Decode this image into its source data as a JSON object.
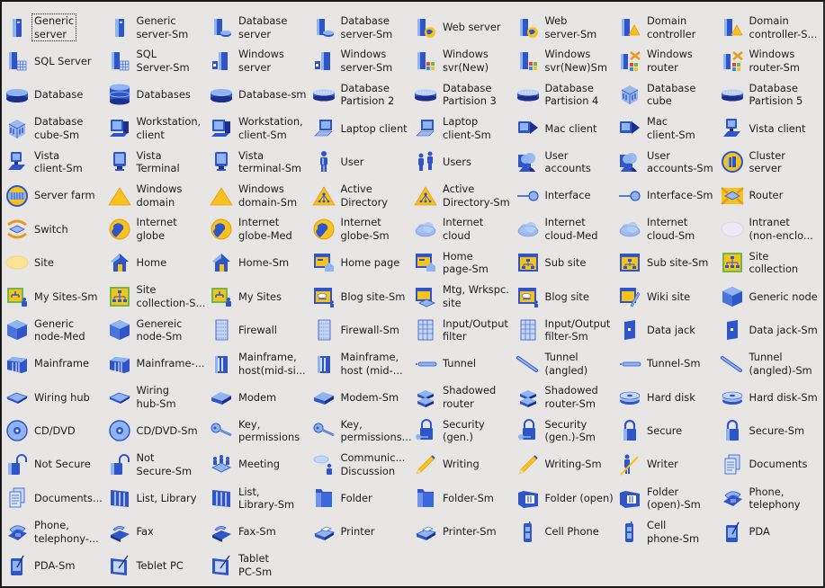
{
  "window": {
    "type": "Visio shape stencil icon view"
  },
  "selected_index": 0,
  "shapes": [
    {
      "label": "Generic\nserver",
      "icon": "generic-server-icon"
    },
    {
      "label": "Generic\nserver-Sm",
      "icon": "generic-server-icon"
    },
    {
      "label": "Database\nserver",
      "icon": "database-server-icon"
    },
    {
      "label": "Database\nserver-Sm",
      "icon": "database-server-icon"
    },
    {
      "label": "Web server",
      "icon": "web-server-icon"
    },
    {
      "label": "Web\nserver-Sm",
      "icon": "web-server-icon"
    },
    {
      "label": "Domain\ncontroller",
      "icon": "domain-controller-icon"
    },
    {
      "label": "Domain\ncontroller-S...",
      "icon": "domain-controller-icon"
    },
    {
      "label": "SQL Server",
      "icon": "sql-server-icon"
    },
    {
      "label": "SQL\nServer-Sm",
      "icon": "sql-server-icon"
    },
    {
      "label": "Windows\nserver",
      "icon": "windows-server-icon"
    },
    {
      "label": "Windows\nserver-Sm",
      "icon": "windows-server-icon"
    },
    {
      "label": "Windows\nsvr(New)",
      "icon": "windows-svr-new-icon"
    },
    {
      "label": "Windows\nsvr(New)Sm",
      "icon": "windows-svr-new-icon"
    },
    {
      "label": "Windows\nrouter",
      "icon": "windows-router-icon"
    },
    {
      "label": "Windows\nrouter-Sm",
      "icon": "windows-router-icon"
    },
    {
      "label": "Database",
      "icon": "database-icon"
    },
    {
      "label": "Databases",
      "icon": "databases-icon"
    },
    {
      "label": "Database-sm",
      "icon": "database-icon"
    },
    {
      "label": "Database\nPartision 2",
      "icon": "database-partition-icon"
    },
    {
      "label": "Database\nPartision 3",
      "icon": "database-partition-icon"
    },
    {
      "label": "Database\nPartision 4",
      "icon": "database-partition-icon"
    },
    {
      "label": "Database\ncube",
      "icon": "database-cube-icon"
    },
    {
      "label": "Database\nPartision 5",
      "icon": "database-partition-icon"
    },
    {
      "label": "Database\ncube-Sm",
      "icon": "database-cube-icon"
    },
    {
      "label": "Workstation,\nclient",
      "icon": "workstation-icon"
    },
    {
      "label": "Workstation,\nclient-Sm",
      "icon": "workstation-icon"
    },
    {
      "label": "Laptop client",
      "icon": "laptop-icon"
    },
    {
      "label": "Laptop\nclient-Sm",
      "icon": "laptop-icon"
    },
    {
      "label": "Mac client",
      "icon": "mac-client-icon"
    },
    {
      "label": "Mac\nclient-Sm",
      "icon": "mac-client-icon"
    },
    {
      "label": "Vista client",
      "icon": "vista-client-icon"
    },
    {
      "label": "Vista\nclient-Sm",
      "icon": "vista-client-icon"
    },
    {
      "label": "Vista\nTerminal",
      "icon": "vista-terminal-icon"
    },
    {
      "label": "Vista\nterminal-Sm",
      "icon": "vista-terminal-icon"
    },
    {
      "label": "User",
      "icon": "user-icon"
    },
    {
      "label": "Users",
      "icon": "users-icon"
    },
    {
      "label": "User\naccounts",
      "icon": "user-accounts-icon"
    },
    {
      "label": "User\naccounts-Sm",
      "icon": "user-accounts-icon"
    },
    {
      "label": "Cluster server",
      "icon": "cluster-server-icon"
    },
    {
      "label": "Server farm",
      "icon": "server-farm-icon"
    },
    {
      "label": "Windows\ndomain",
      "icon": "windows-domain-icon"
    },
    {
      "label": "Windows\ndomain-Sm",
      "icon": "windows-domain-icon"
    },
    {
      "label": "Active\nDirectory",
      "icon": "active-directory-icon"
    },
    {
      "label": "Active\nDirectory-Sm",
      "icon": "active-directory-icon"
    },
    {
      "label": "Interface",
      "icon": "interface-icon"
    },
    {
      "label": "Interface-Sm",
      "icon": "interface-icon"
    },
    {
      "label": "Router",
      "icon": "router-icon"
    },
    {
      "label": "Switch",
      "icon": "switch-icon"
    },
    {
      "label": "Internet\nglobe",
      "icon": "internet-globe-icon"
    },
    {
      "label": "Internet\nglobe-Med",
      "icon": "internet-globe-icon"
    },
    {
      "label": "Internet\nglobe-Sm",
      "icon": "internet-globe-icon"
    },
    {
      "label": "Internet\ncloud",
      "icon": "internet-cloud-icon"
    },
    {
      "label": "Internet\ncloud-Med",
      "icon": "internet-cloud-icon"
    },
    {
      "label": "Internet\ncloud-Sm",
      "icon": "internet-cloud-icon"
    },
    {
      "label": "Intranet\n(non-enclo...",
      "icon": "intranet-icon"
    },
    {
      "label": "Site",
      "icon": "site-icon"
    },
    {
      "label": "Home",
      "icon": "home-icon"
    },
    {
      "label": "Home-Sm",
      "icon": "home-icon"
    },
    {
      "label": "Home page",
      "icon": "home-page-icon"
    },
    {
      "label": "Home\npage-Sm",
      "icon": "home-page-icon"
    },
    {
      "label": "Sub site",
      "icon": "sub-site-icon"
    },
    {
      "label": "Sub site-Sm",
      "icon": "sub-site-icon"
    },
    {
      "label": "Site\ncollection",
      "icon": "site-collection-icon"
    },
    {
      "label": "My Sites-Sm",
      "icon": "my-sites-icon"
    },
    {
      "label": "Site\ncollection-S...",
      "icon": "site-collection-icon"
    },
    {
      "label": "My Sites",
      "icon": "my-sites-icon"
    },
    {
      "label": "Blog site-Sm",
      "icon": "blog-site-icon"
    },
    {
      "label": "Mtg, Wrkspc.\nsite",
      "icon": "meeting-workspace-icon"
    },
    {
      "label": "Blog site",
      "icon": "blog-site-icon"
    },
    {
      "label": "Wiki site",
      "icon": "wiki-site-icon"
    },
    {
      "label": "Generic node",
      "icon": "generic-node-icon"
    },
    {
      "label": "Generic\nnode-Med",
      "icon": "generic-node-icon"
    },
    {
      "label": "Genereic\nnode-Sm",
      "icon": "generic-node-icon"
    },
    {
      "label": "Firewall",
      "icon": "firewall-icon"
    },
    {
      "label": "Firewall-Sm",
      "icon": "firewall-icon"
    },
    {
      "label": "Input/Output\nfilter",
      "icon": "io-filter-icon"
    },
    {
      "label": "Input/Output\nfilter-Sm",
      "icon": "io-filter-icon"
    },
    {
      "label": "Data jack",
      "icon": "data-jack-icon"
    },
    {
      "label": "Data jack-Sm",
      "icon": "data-jack-icon"
    },
    {
      "label": "Mainframe",
      "icon": "mainframe-icon"
    },
    {
      "label": "Mainframe-...",
      "icon": "mainframe-icon"
    },
    {
      "label": "Mainframe,\nhost(mid-si...",
      "icon": "mainframe-host-icon"
    },
    {
      "label": "Mainframe,\nhost (mid-...",
      "icon": "mainframe-host-icon"
    },
    {
      "label": "Tunnel",
      "icon": "tunnel-icon"
    },
    {
      "label": "Tunnel\n(angled)",
      "icon": "tunnel-angled-icon"
    },
    {
      "label": "Tunnel-Sm",
      "icon": "tunnel-icon"
    },
    {
      "label": "Tunnel\n(angled)-Sm",
      "icon": "tunnel-angled-icon"
    },
    {
      "label": "Wiring hub",
      "icon": "wiring-hub-icon"
    },
    {
      "label": "Wiring\nhub-Sm",
      "icon": "wiring-hub-icon"
    },
    {
      "label": "Modem",
      "icon": "modem-icon"
    },
    {
      "label": "Modem-Sm",
      "icon": "modem-icon"
    },
    {
      "label": "Shadowed\nrouter",
      "icon": "shadowed-router-icon"
    },
    {
      "label": "Shadowed\nrouter-Sm",
      "icon": "shadowed-router-icon"
    },
    {
      "label": "Hard disk",
      "icon": "hard-disk-icon"
    },
    {
      "label": "Hard disk-Sm",
      "icon": "hard-disk-icon"
    },
    {
      "label": "CD/DVD",
      "icon": "cd-dvd-icon"
    },
    {
      "label": "CD/DVD-Sm",
      "icon": "cd-dvd-icon"
    },
    {
      "label": "Key,\npermissions",
      "icon": "key-icon"
    },
    {
      "label": "Key,\npermissions...",
      "icon": "key-icon"
    },
    {
      "label": "Security\n(gen.)",
      "icon": "security-icon"
    },
    {
      "label": "Security\n(gen.)-Sm",
      "icon": "security-icon"
    },
    {
      "label": "Secure",
      "icon": "lock-icon"
    },
    {
      "label": "Secure-Sm",
      "icon": "lock-icon"
    },
    {
      "label": "Not Secure",
      "icon": "unlock-icon"
    },
    {
      "label": "Not\nSecure-Sm",
      "icon": "unlock-icon"
    },
    {
      "label": "Meeting",
      "icon": "meeting-icon"
    },
    {
      "label": "Communic...\nDiscussion",
      "icon": "discussion-icon"
    },
    {
      "label": "Writing",
      "icon": "pencil-icon"
    },
    {
      "label": "Writing-Sm",
      "icon": "pencil-icon"
    },
    {
      "label": "Writer",
      "icon": "writer-icon"
    },
    {
      "label": "Documents",
      "icon": "documents-icon"
    },
    {
      "label": "Documents...",
      "icon": "documents-icon"
    },
    {
      "label": "List, Library",
      "icon": "list-library-icon"
    },
    {
      "label": "List,\nLibrary-Sm",
      "icon": "list-library-icon"
    },
    {
      "label": "Folder",
      "icon": "folder-icon"
    },
    {
      "label": "Folder-Sm",
      "icon": "folder-icon"
    },
    {
      "label": "Folder (open)",
      "icon": "folder-open-icon"
    },
    {
      "label": "Folder\n(open)-Sm",
      "icon": "folder-open-icon"
    },
    {
      "label": "Phone,\ntelephony",
      "icon": "phone-icon"
    },
    {
      "label": "Phone,\ntelephony-...",
      "icon": "phone-icon"
    },
    {
      "label": "Fax",
      "icon": "fax-icon"
    },
    {
      "label": "Fax-Sm",
      "icon": "fax-icon"
    },
    {
      "label": "Printer",
      "icon": "printer-icon"
    },
    {
      "label": "Printer-Sm",
      "icon": "printer-icon"
    },
    {
      "label": "Cell Phone",
      "icon": "cell-phone-icon"
    },
    {
      "label": "Cell\nphone-Sm",
      "icon": "cell-phone-icon"
    },
    {
      "label": "PDA",
      "icon": "pda-icon"
    },
    {
      "label": "PDA-Sm",
      "icon": "pda-icon"
    },
    {
      "label": "Teblet PC",
      "icon": "tablet-pc-icon"
    },
    {
      "label": "Tablet\nPC-Sm",
      "icon": "tablet-pc-icon"
    }
  ],
  "colors": {
    "background": "#e8e6e4",
    "icon_blue": "#2f55c8",
    "icon_light_blue": "#8fb4f0",
    "icon_yellow": "#f6c21c",
    "text": "#1c1c1c"
  }
}
